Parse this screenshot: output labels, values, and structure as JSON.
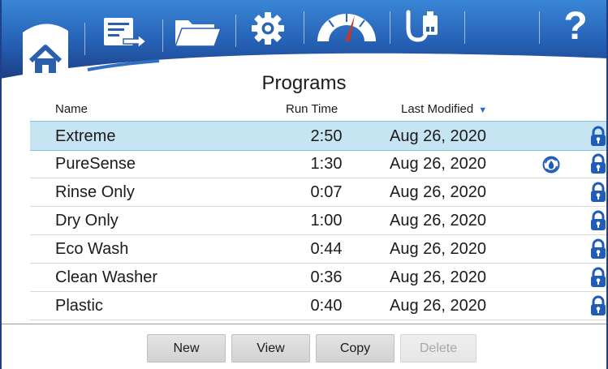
{
  "toolbar": {
    "buttons": [
      {
        "icon": "home-icon",
        "active": true
      },
      {
        "icon": "program-list-icon",
        "active": false
      },
      {
        "icon": "folder-icon",
        "active": false
      },
      {
        "icon": "gear-icon",
        "active": false
      },
      {
        "icon": "gauge-icon",
        "active": false
      },
      {
        "icon": "usb-icon",
        "active": false
      },
      {
        "icon": "help-icon",
        "active": false
      }
    ],
    "help_label": "?"
  },
  "page": {
    "title": "Programs"
  },
  "columns": {
    "name": "Name",
    "run_time": "Run Time",
    "last_modified": "Last Modified",
    "sort_indicator": "▼"
  },
  "programs": [
    {
      "name": "Extreme",
      "run_time": "2:50",
      "last_modified": "Aug 26, 2020",
      "selected": true,
      "autodose": false,
      "locked": true
    },
    {
      "name": "PureSense",
      "run_time": "1:30",
      "last_modified": "Aug 26, 2020",
      "selected": false,
      "autodose": true,
      "locked": true
    },
    {
      "name": "Rinse Only",
      "run_time": "0:07",
      "last_modified": "Aug 26, 2020",
      "selected": false,
      "autodose": false,
      "locked": true
    },
    {
      "name": "Dry Only",
      "run_time": "1:00",
      "last_modified": "Aug 26, 2020",
      "selected": false,
      "autodose": false,
      "locked": true
    },
    {
      "name": "Eco Wash",
      "run_time": "0:44",
      "last_modified": "Aug 26, 2020",
      "selected": false,
      "autodose": false,
      "locked": true
    },
    {
      "name": "Clean Washer",
      "run_time": "0:36",
      "last_modified": "Aug 26, 2020",
      "selected": false,
      "autodose": false,
      "locked": true
    },
    {
      "name": "Plastic",
      "run_time": "0:40",
      "last_modified": "Aug 26, 2020",
      "selected": false,
      "autodose": false,
      "locked": true
    }
  ],
  "actions": {
    "new": "New",
    "view": "View",
    "copy": "Copy",
    "delete": "Delete",
    "delete_disabled": true
  },
  "colors": {
    "toolbar_dark": "#1d4388",
    "toolbar_light": "#2e73c6",
    "selection": "#c6e4f2",
    "lock": "#1f5db8"
  }
}
